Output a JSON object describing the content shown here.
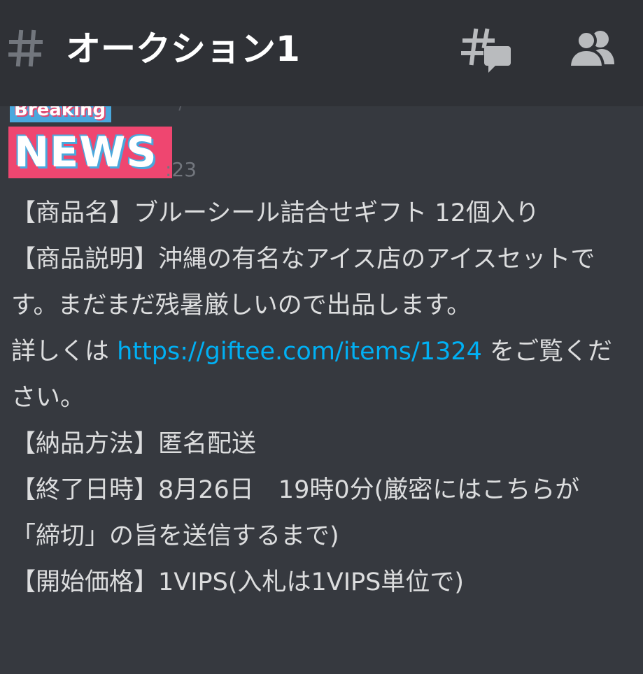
{
  "header": {
    "channel_name": "オークション1",
    "icons": {
      "channel": "hash-icon",
      "threads": "threads-icon",
      "members": "members-icon"
    },
    "colors": {
      "background": "#2f3136",
      "icon": "#b9bbbe",
      "title": "#ffffff"
    }
  },
  "message": {
    "avatar": {
      "badge_top": "Breaking",
      "badge_bottom": "NEWS",
      "colors": {
        "blue": "#4aa8dd",
        "pink": "#ef4670"
      }
    },
    "timestamp": ":23",
    "lines": {
      "product_name": "【商品名】ブルーシール詰合せギフト 12個入り",
      "product_desc": "【商品説明】沖縄の有名なアイス店のアイスセットです。まだまだ残暑厳しいので出品します。",
      "details_prefix": "詳しくは ",
      "details_link": "https://giftee.com/items/1324",
      "details_suffix": " をご覧ください。",
      "delivery": "【納品方法】匿名配送",
      "end_time": "【終了日時】8月26日　19時0分(厳密にはこちらが「締切」の旨を送信するまで)",
      "start_price": "【開始価格】1VIPS(入札は1VIPS単位で)"
    },
    "colors": {
      "text": "#dcddde",
      "link": "#00b0f4",
      "timestamp": "#72767d"
    }
  }
}
